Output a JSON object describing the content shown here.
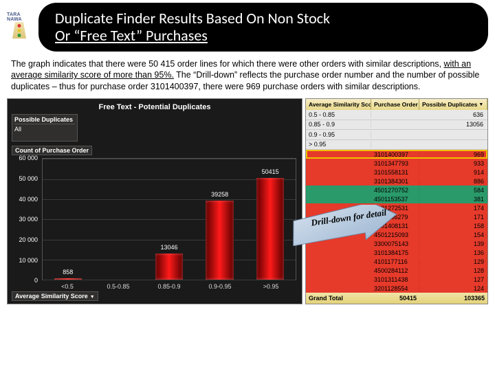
{
  "logo": {
    "brand": "TARA NAWA"
  },
  "title": {
    "line1": "Duplicate Finder Results Based On  Non Stock",
    "line2": "Or “Free Text” Purchases"
  },
  "description": {
    "p1a": "The graph indicates that there were 50 415 order lines for which there were other orders with similar descriptions, ",
    "p1b": "with an average similarity score of more than 95%.",
    "p1c": " The “Drill-down” reflects the purchase order number and the number of possible duplicates – thus for purchase order 3101400397, there were 969 purchase orders with similar descriptions."
  },
  "arrow_label": "Drill-down for detail",
  "chart_data": {
    "type": "bar",
    "title": "Free Text - Potential Duplicates",
    "filter_header": "Possible Duplicates",
    "filter_value": "All",
    "sub_header": "Count of Purchase Order",
    "x_axis_title": "Average Similarity Score",
    "categories": [
      "<0.5",
      "0.5-0.85",
      "0.85-0.9",
      "0.9-0.95",
      ">0.95"
    ],
    "values": [
      858,
      null,
      13046,
      39258,
      50415
    ],
    "labels": [
      "858",
      "",
      "13046",
      "39258",
      "50415"
    ],
    "ylim": [
      0,
      60000
    ],
    "yticks": [
      0,
      10000,
      20000,
      30000,
      40000,
      50000,
      60000
    ],
    "ytick_labels": [
      "0",
      "10 000",
      "20 000",
      "30 000",
      "40 000",
      "50 000",
      "60 000"
    ]
  },
  "table": {
    "columns": [
      "Average Similarity Score",
      "Purchase Order",
      "Possible Duplicates"
    ],
    "buckets": [
      {
        "range": "0.5 - 0.85",
        "total": "636"
      },
      {
        "range": "0.85 - 0.9",
        "total": "13056"
      },
      {
        "range": "0.9 - 0.95",
        "total": ""
      },
      {
        "range": "> 0.95",
        "total": ""
      }
    ],
    "rows": [
      {
        "po": "3101400397",
        "dup": "969",
        "tone": "hot",
        "sel": true
      },
      {
        "po": "3101347793",
        "dup": "933",
        "tone": "hot"
      },
      {
        "po": "3101558131",
        "dup": "914",
        "tone": "hot"
      },
      {
        "po": "3101384301",
        "dup": "886",
        "tone": "hot"
      },
      {
        "po": "4501270752",
        "dup": "584",
        "tone": "cool"
      },
      {
        "po": "4501153537",
        "dup": "381",
        "tone": "cool"
      },
      {
        "po": "3101272531",
        "dup": "174",
        "tone": "hot"
      },
      {
        "po": "3101186279",
        "dup": "171",
        "tone": "hot"
      },
      {
        "po": "3101408131",
        "dup": "158",
        "tone": "hot"
      },
      {
        "po": "4501215093",
        "dup": "154",
        "tone": "hot"
      },
      {
        "po": "3300075143",
        "dup": "139",
        "tone": "hot"
      },
      {
        "po": "3101384175",
        "dup": "136",
        "tone": "hot"
      },
      {
        "po": "4101177116",
        "dup": "129",
        "tone": "hot"
      },
      {
        "po": "4500284112",
        "dup": "128",
        "tone": "hot"
      },
      {
        "po": "3101311438",
        "dup": "127",
        "tone": "hot"
      },
      {
        "po": "3201128554",
        "dup": "124",
        "tone": "hot"
      }
    ],
    "footer": {
      "label": "Grand Total",
      "count": "50415",
      "dup": "103365"
    }
  }
}
